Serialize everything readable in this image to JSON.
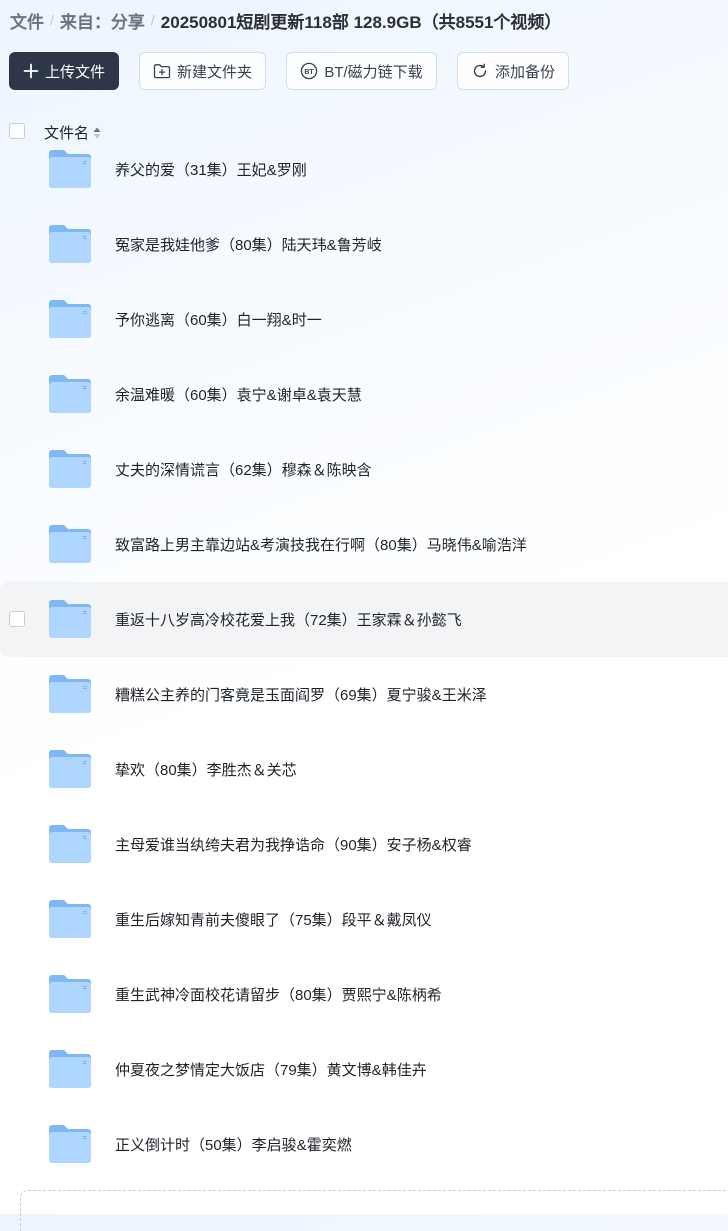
{
  "breadcrumb": {
    "root": "文件",
    "parent": "来自：分享",
    "current": "20250801短剧更新118部 128.9GB（共8551个视频）",
    "separator": "/"
  },
  "toolbar": {
    "upload_label": "上传文件",
    "new_folder_label": "新建文件夹",
    "bt_label": "BT/磁力链下载",
    "backup_label": "添加备份"
  },
  "list_header": {
    "name_label": "文件名"
  },
  "icons": {
    "upload": "plus-icon",
    "new_folder": "folder-plus-icon",
    "bt": "bt-icon",
    "backup": "sync-icon",
    "sort": "sort-icon",
    "folder": "folder-icon"
  },
  "colors": {
    "primary_button": "#2d3748",
    "folder_light": "#aed6ff",
    "folder_dark": "#7fb8f5",
    "hover_row": "#f3f4f6"
  },
  "files": [
    {
      "name": "养父的爱（31集）王妃&罗刚"
    },
    {
      "name": "冤家是我娃他爹（80集）陆天玮&鲁芳岐"
    },
    {
      "name": "予你逃离（60集）白一翔&时一"
    },
    {
      "name": "余温难暖（60集）袁宁&谢卓&袁天慧"
    },
    {
      "name": "丈夫的深情谎言（62集）穆森＆陈映含"
    },
    {
      "name": "致富路上男主靠边站&考演技我在行啊（80集）马晓伟&喻浩洋"
    },
    {
      "name": "重返十八岁高冷校花爱上我（72集）王家霖＆孙懿飞"
    },
    {
      "name": "糟糕公主养的门客竟是玉面阎罗（69集）夏宁骏&王米泽"
    },
    {
      "name": "挚欢（80集）李胜杰＆关芯"
    },
    {
      "name": "主母爱谁当纨绔夫君为我挣诰命（90集）安子杨&权睿"
    },
    {
      "name": "重生后嫁知青前夫傻眼了（75集）段平＆戴凤仪"
    },
    {
      "name": "重生武神冷面校花请留步（80集）贾熙宁&陈柄希"
    },
    {
      "name": "仲夏夜之梦情定大饭店（79集）黄文博&韩佳卉"
    },
    {
      "name": "正义倒计时（50集）李启骏&霍奕燃"
    }
  ]
}
